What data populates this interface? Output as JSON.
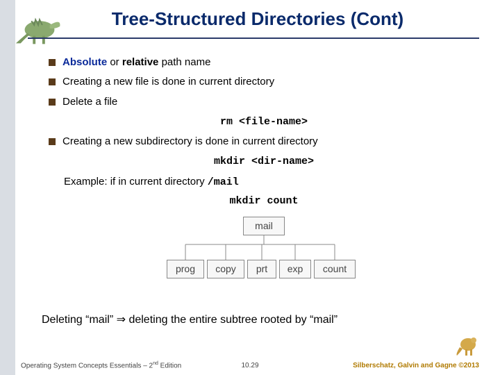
{
  "title": "Tree-Structured Directories (Cont)",
  "bullets": {
    "b1_absolute": "Absolute",
    "b1_sep": " or ",
    "b1_relative": "relative",
    "b1_rest": " path name",
    "b2": "Creating a new file is done in current directory",
    "b3": "Delete a file",
    "b3_code": "rm <file-name>",
    "b4": "Creating a new subdirectory is done in current directory",
    "b4_code": "mkdir <dir-name>",
    "example_prefix": "Example:  if in current directory  ",
    "example_path": "/mail",
    "example_cmd": "mkdir count"
  },
  "tree": {
    "root": "mail",
    "children": [
      "prog",
      "copy",
      "prt",
      "exp",
      "count"
    ]
  },
  "delete_note_a": "Deleting “mail” ",
  "delete_note_arrow": "⇒",
  "delete_note_b": " deleting the entire subtree rooted by “mail”",
  "footer": {
    "left_a": "Operating System Concepts Essentials – 2",
    "left_sup": "nd",
    "left_b": " Edition",
    "mid": "10.29",
    "right": "Silberschatz, Galvin and Gagne ©2013"
  }
}
